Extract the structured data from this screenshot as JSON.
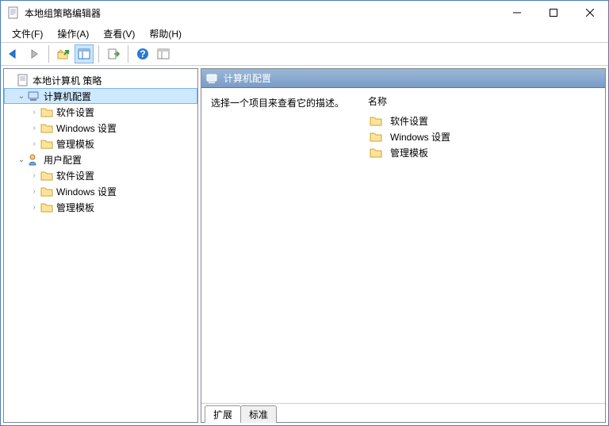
{
  "window": {
    "title": "本地组策略编辑器"
  },
  "menu": {
    "file": "文件(F)",
    "action": "操作(A)",
    "view": "查看(V)",
    "help": "帮助(H)"
  },
  "tree": {
    "root": "本地计算机 策略",
    "comp": "计算机配置",
    "user": "用户配置",
    "sw": "软件设置",
    "win": "Windows 设置",
    "admin": "管理模板"
  },
  "right": {
    "header": "计算机配置",
    "hint": "选择一个项目来查看它的描述。",
    "colName": "名称",
    "items": {
      "sw": "软件设置",
      "win": "Windows 设置",
      "admin": "管理模板"
    }
  },
  "tabs": {
    "extended": "扩展",
    "standard": "标准"
  }
}
